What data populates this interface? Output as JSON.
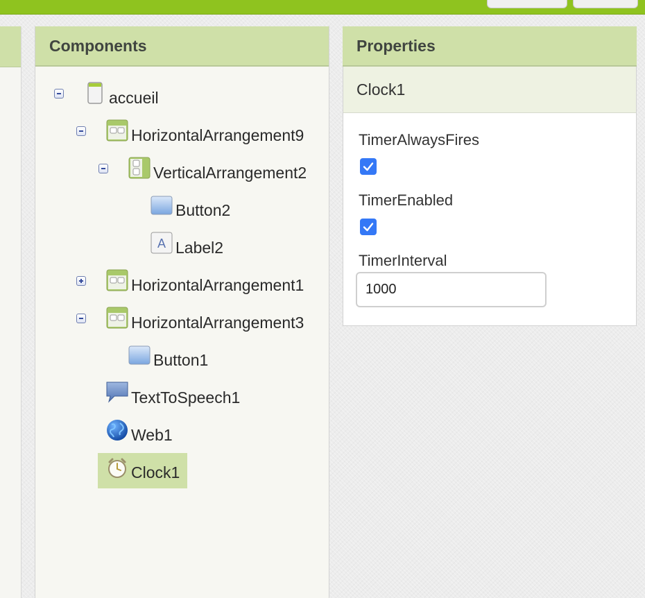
{
  "components_panel": {
    "title": "Components",
    "tree": [
      {
        "label": "accueil",
        "icon": "screen-icon",
        "toggle": "collapse"
      },
      {
        "label": "HorizontalArrangement9",
        "icon": "horizontal-arrangement-icon",
        "toggle": "collapse"
      },
      {
        "label": "VerticalArrangement2",
        "icon": "vertical-arrangement-icon",
        "toggle": "collapse"
      },
      {
        "label": "Button2",
        "icon": "button-icon",
        "toggle": null
      },
      {
        "label": "Label2",
        "icon": "label-icon",
        "toggle": null
      },
      {
        "label": "HorizontalArrangement1",
        "icon": "horizontal-arrangement-icon",
        "toggle": "expand"
      },
      {
        "label": "HorizontalArrangement3",
        "icon": "horizontal-arrangement-icon",
        "toggle": "collapse"
      },
      {
        "label": "Button1",
        "icon": "button-icon",
        "toggle": null
      },
      {
        "label": "TextToSpeech1",
        "icon": "text-to-speech-icon",
        "toggle": null
      },
      {
        "label": "Web1",
        "icon": "web-globe-icon",
        "toggle": null
      },
      {
        "label": "Clock1",
        "icon": "clock-icon",
        "toggle": null,
        "selected": true
      }
    ]
  },
  "properties_panel": {
    "title": "Properties",
    "component_name": "Clock1",
    "timer_always_fires": {
      "label": "TimerAlwaysFires",
      "checked": true
    },
    "timer_enabled": {
      "label": "TimerEnabled",
      "checked": true
    },
    "timer_interval": {
      "label": "TimerInterval",
      "value": "1000"
    }
  },
  "colors": {
    "toolbar_green": "#8fc31f",
    "panel_header": "#cfe0a8",
    "selection": "#cfe0a8",
    "checkbox_blue": "#3478f6"
  }
}
